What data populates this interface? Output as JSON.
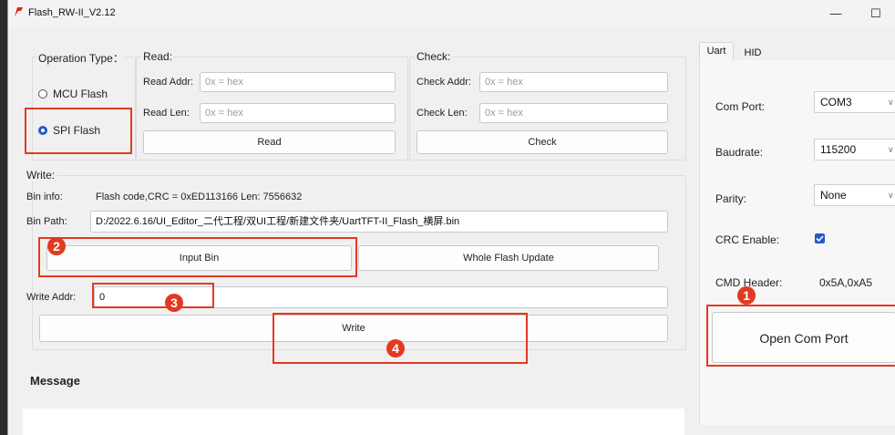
{
  "window": {
    "title": "Flash_RW-II_V2.12",
    "minimize_glyph": "—",
    "maximize_glyph": "☐"
  },
  "operation": {
    "title": "Operation Type：",
    "mcu_label": "MCU Flash",
    "spi_label": "SPI Flash",
    "selected": "SPI Flash"
  },
  "read": {
    "title": "Read:",
    "addr_label": "Read Addr:",
    "addr_placeholder": "0x = hex",
    "len_label": "Read Len:",
    "len_placeholder": "0x = hex",
    "button": "Read"
  },
  "check": {
    "title": "Check:",
    "addr_label": "Check Addr:",
    "addr_placeholder": "0x = hex",
    "len_label": "Check Len:",
    "len_placeholder": "0x = hex",
    "button": "Check"
  },
  "write": {
    "title": "Write:",
    "bin_info_label": "Bin info:",
    "bin_info_value": "Flash code,CRC = 0xED113166  Len: 7556632",
    "bin_path_label": "Bin Path:",
    "bin_path_value": "D:/2022.6.16/UI_Editor_二代工程/双UI工程/新建文件夹/UartTFT-II_Flash_横屏.bin",
    "input_bin_button": "Input Bin",
    "whole_flash_button": "Whole Flash Update",
    "addr_label": "Write Addr:",
    "addr_value": "0",
    "write_button": "Write"
  },
  "message": {
    "title": "Message"
  },
  "side": {
    "tabs": [
      "Uart",
      "HID"
    ],
    "active_tab": "Uart",
    "com_port_label": "Com Port:",
    "com_port_value": "COM3",
    "baudrate_label": "Baudrate:",
    "baudrate_value": "115200",
    "parity_label": "Parity:",
    "parity_value": "None",
    "crc_label": "CRC Enable:",
    "crc_checked": true,
    "cmd_header_label": "CMD Header:",
    "cmd_header_value": "0x5A,0xA5",
    "open_button": "Open Com Port"
  },
  "annotations": {
    "colors": {
      "highlight": "#e23a22",
      "accent": "#2459c7"
    },
    "badges": [
      "1",
      "2",
      "3",
      "4"
    ]
  }
}
